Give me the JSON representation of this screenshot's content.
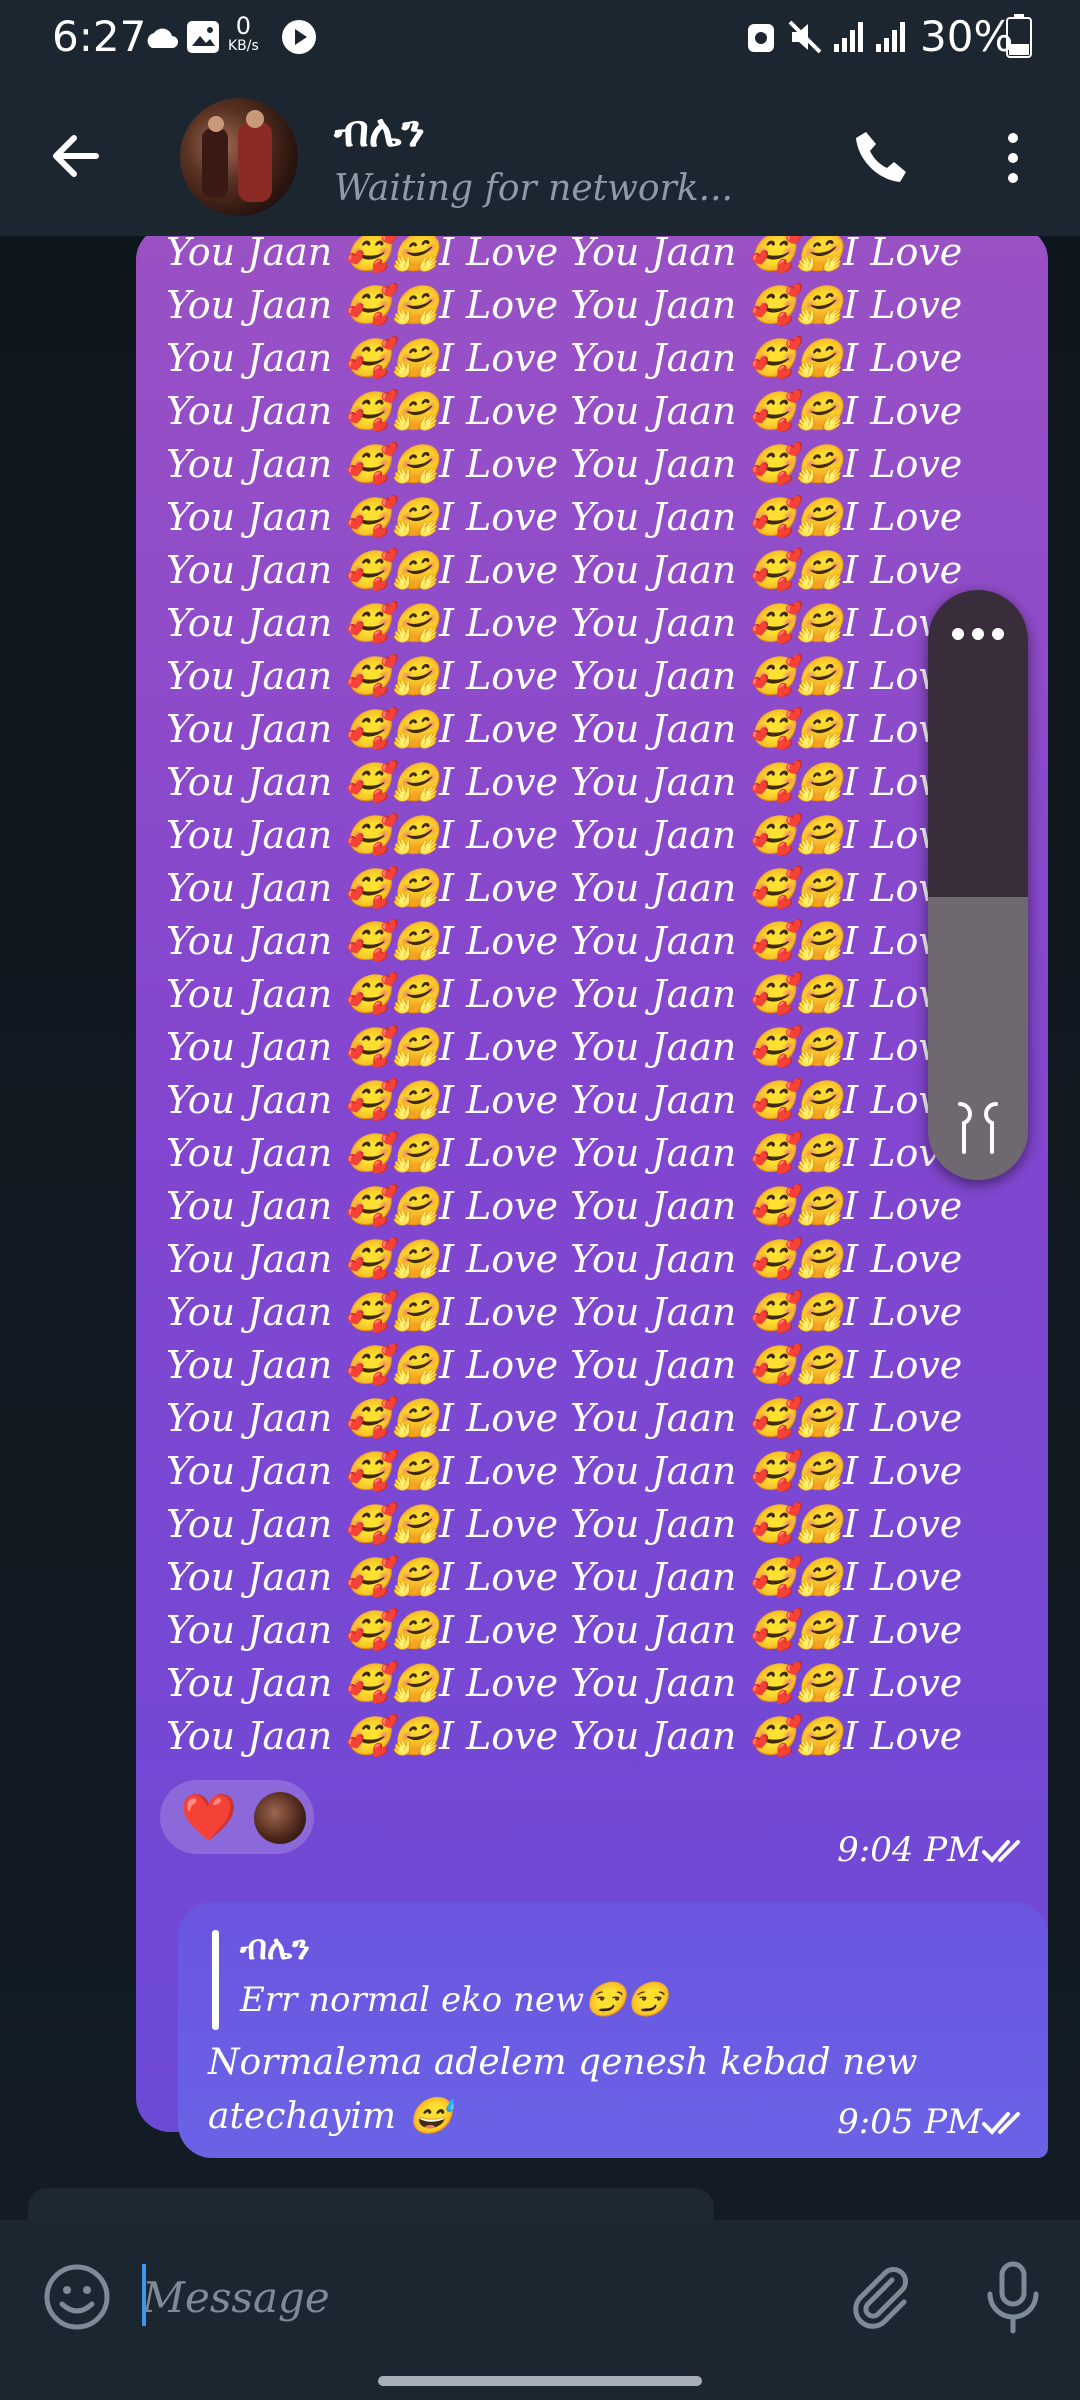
{
  "status_bar": {
    "time": "6:27",
    "net_speed_value": "0",
    "net_speed_unit": "KB/s",
    "battery": "30%"
  },
  "header": {
    "contact_name": "ብሌን",
    "status": "Waiting for network...",
    "icons": [
      "back-arrow-icon",
      "phone-icon",
      "more-vert-icon"
    ]
  },
  "messages": {
    "incoming": {
      "text": "You Jaan 🥰🤗I Love You Jaan 🥰🤗I Love You Jaan 🥰🤗I Love You Jaan 🥰🤗I Love You Jaan 🥰🤗I Love You Jaan 🥰🤗I Love You Jaan 🥰🤗I Love You Jaan 🥰🤗I Love You Jaan 🥰🤗I Love You Jaan 🥰🤗I Love You Jaan 🥰🤗I Love You Jaan 🥰🤗I Love You Jaan 🥰🤗I Love You Jaan 🥰🤗I Love You Jaan 🥰🤗I Love You Jaan 🥰🤗I Love You Jaan 🥰🤗I Love You Jaan 🥰🤗I Love You Jaan 🥰🤗I Love You Jaan 🥰🤗I Love You Jaan 🥰🤗I Love You Jaan 🥰🤗I Love You Jaan 🥰🤗I Love You Jaan 🥰🤗I Love You Jaan 🥰🤗I Love You Jaan 🥰🤗I Love You Jaan 🥰🤗I Love You Jaan 🥰🤗I Love You Jaan 🥰🤗I Love You Jaan 🥰🤗I Love You Jaan 🥰🤗I Love You Jaan 🥰🤗I Love You Jaan 🥰🤗I Love You Jaan 🥰🤗I Love You Jaan 🥰🤗I Love You Jaan 🥰🤗I Love You Jaan 🥰🤗I Love You Jaan 🥰🤗I Love You Jaan 🥰🤗I Love You Jaan 🥰🤗I Love You Jaan 🥰🤗I Love You Jaan 🥰🤗I Love You Jaan 🥰🤗I Love You Jaan 🥰🤗I Love You Jaan 🥰🤗I Love You Jaan 🥰🤗I Love You Jaan 🥰🤗I Love You Jaan 🥰🤗I Love You Jaan 🥰🤗I Love You Jaan 🥰🤗I Love You Jaan 🥰🤗I Love You Jaan 🥰🤗I Love You Jaan 🥰🤗I Love You Jaan 🥰🤗I Love You Jaan 🥰🤗I Love You Jaan 🥰🤗I Love You Jaan 🥰🤗I Love You Jaan 🥰🤗I Love You Jaan 🥰🤗I Love You Jaan 🥰🤗I Love You Jaan 🥰🤗I Love You Jaan 🥰🤗I Love You Jaan 🥰🤗I Love You Jaan 🥰🤗",
      "reaction": "❤️",
      "time": "9:04 PM"
    },
    "outgoing": {
      "reply_to_name": "ብሌን",
      "reply_to_text": "Err normal eko new😏😏",
      "text": "Normalema adelem qenesh kebad new atechayim 😅",
      "time": "9:05 PM"
    }
  },
  "input": {
    "placeholder": "Message"
  },
  "colors": {
    "header_bg": "#1c2631",
    "incoming_top": "#9a51c4",
    "incoming_bottom": "#6c4ad6",
    "outgoing": "#6a5fe3",
    "caret": "#3f95e8"
  }
}
